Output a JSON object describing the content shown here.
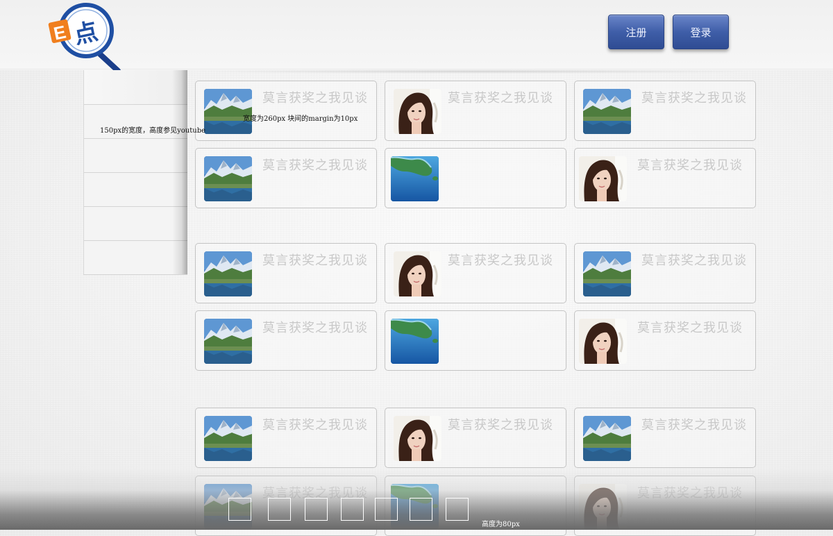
{
  "header": {
    "logo_letter": "E",
    "logo_char": "点",
    "register_label": "注册",
    "login_label": "登录"
  },
  "sidebar": {
    "items": [
      "",
      "",
      "",
      "",
      "",
      ""
    ],
    "note": "150px的宽度，高度参见youtube"
  },
  "notes": {
    "width_note": "宽度为260px  块间的margin为10px",
    "height_note": "高度为80px"
  },
  "cards": [
    {
      "title": "莫言获奖之我见谈",
      "thumb": "mountain-lake-thumbnail"
    },
    {
      "title": "莫言获奖之我见谈",
      "thumb": "woman-portrait-thumbnail"
    },
    {
      "title": "莫言获奖之我见谈",
      "thumb": "mountain-lake-thumbnail"
    },
    {
      "title": "莫言获奖之我见谈",
      "thumb": "mountain-lake-thumbnail"
    },
    {
      "title": "",
      "thumb": "island-sea-thumbnail"
    },
    {
      "title": "莫言获奖之我见谈",
      "thumb": "woman-portrait-thumbnail"
    },
    {
      "title": "莫言获奖之我见谈",
      "thumb": "mountain-lake-thumbnail"
    },
    {
      "title": "莫言获奖之我见谈",
      "thumb": "woman-portrait-thumbnail"
    },
    {
      "title": "莫言获奖之我见谈",
      "thumb": "mountain-lake-thumbnail"
    },
    {
      "title": "莫言获奖之我见谈",
      "thumb": "mountain-lake-thumbnail"
    },
    {
      "title": "",
      "thumb": "island-sea-thumbnail"
    },
    {
      "title": "莫言获奖之我见谈",
      "thumb": "woman-portrait-thumbnail"
    },
    {
      "title": "莫言获奖之我见谈",
      "thumb": "mountain-lake-thumbnail"
    },
    {
      "title": "莫言获奖之我见谈",
      "thumb": "woman-portrait-thumbnail"
    },
    {
      "title": "莫言获奖之我见谈",
      "thumb": "mountain-lake-thumbnail"
    },
    {
      "title": "莫言获奖之我见谈",
      "thumb": "mountain-lake-thumbnail"
    },
    {
      "title": "",
      "thumb": "island-sea-thumbnail"
    },
    {
      "title": "莫言获奖之我见谈",
      "thumb": "woman-portrait-thumbnail"
    }
  ],
  "pager": {
    "count": 7
  },
  "colors": {
    "button_blue": "#3f5ea8",
    "logo_blue": "#1f4fa3",
    "logo_orange": "#f07f1e"
  }
}
